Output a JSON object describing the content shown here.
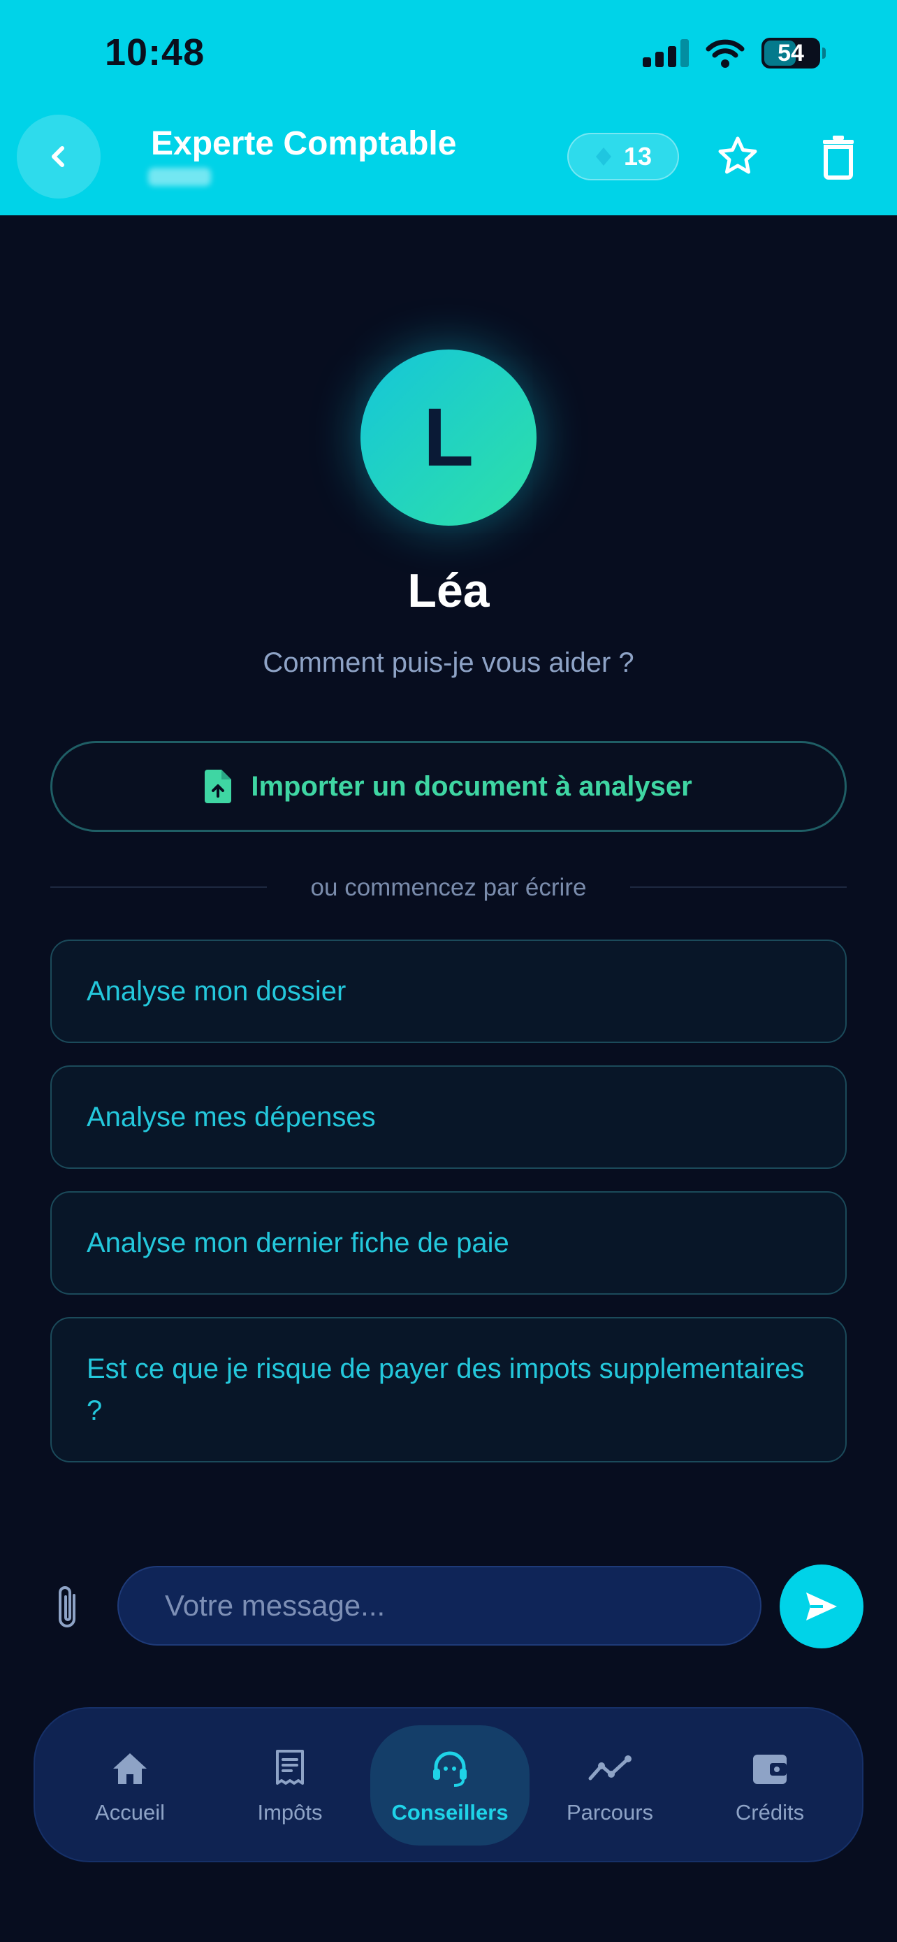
{
  "status_bar": {
    "time": "10:48",
    "battery": "54"
  },
  "header": {
    "title": "Experte Comptable",
    "credits": "13"
  },
  "advisor": {
    "initial": "L",
    "name": "Léa",
    "greeting": "Comment puis-je vous aider ?"
  },
  "import_button": {
    "label": "Importer un document à analyser"
  },
  "divider_text": "ou commencez par écrire",
  "suggestions": [
    {
      "label": "Analyse mon dossier"
    },
    {
      "label": "Analyse mes dépenses"
    },
    {
      "label": "Analyse mon dernier fiche de paie"
    },
    {
      "label": "Est ce que je risque de payer des impots supplementaires ?"
    }
  ],
  "composer": {
    "placeholder": "Votre message..."
  },
  "nav": {
    "items": [
      {
        "label": "Accueil",
        "icon": "home-icon"
      },
      {
        "label": "Impôts",
        "icon": "receipt-icon"
      },
      {
        "label": "Conseillers",
        "icon": "headset-icon",
        "active": true
      },
      {
        "label": "Parcours",
        "icon": "trend-icon"
      },
      {
        "label": "Crédits",
        "icon": "wallet-icon"
      }
    ]
  },
  "colors": {
    "header": "#00d3e8",
    "background": "#070d1f",
    "accent": "#24c8dc",
    "import_green": "#3fd6a3",
    "nav_bg": "#0f2352"
  }
}
